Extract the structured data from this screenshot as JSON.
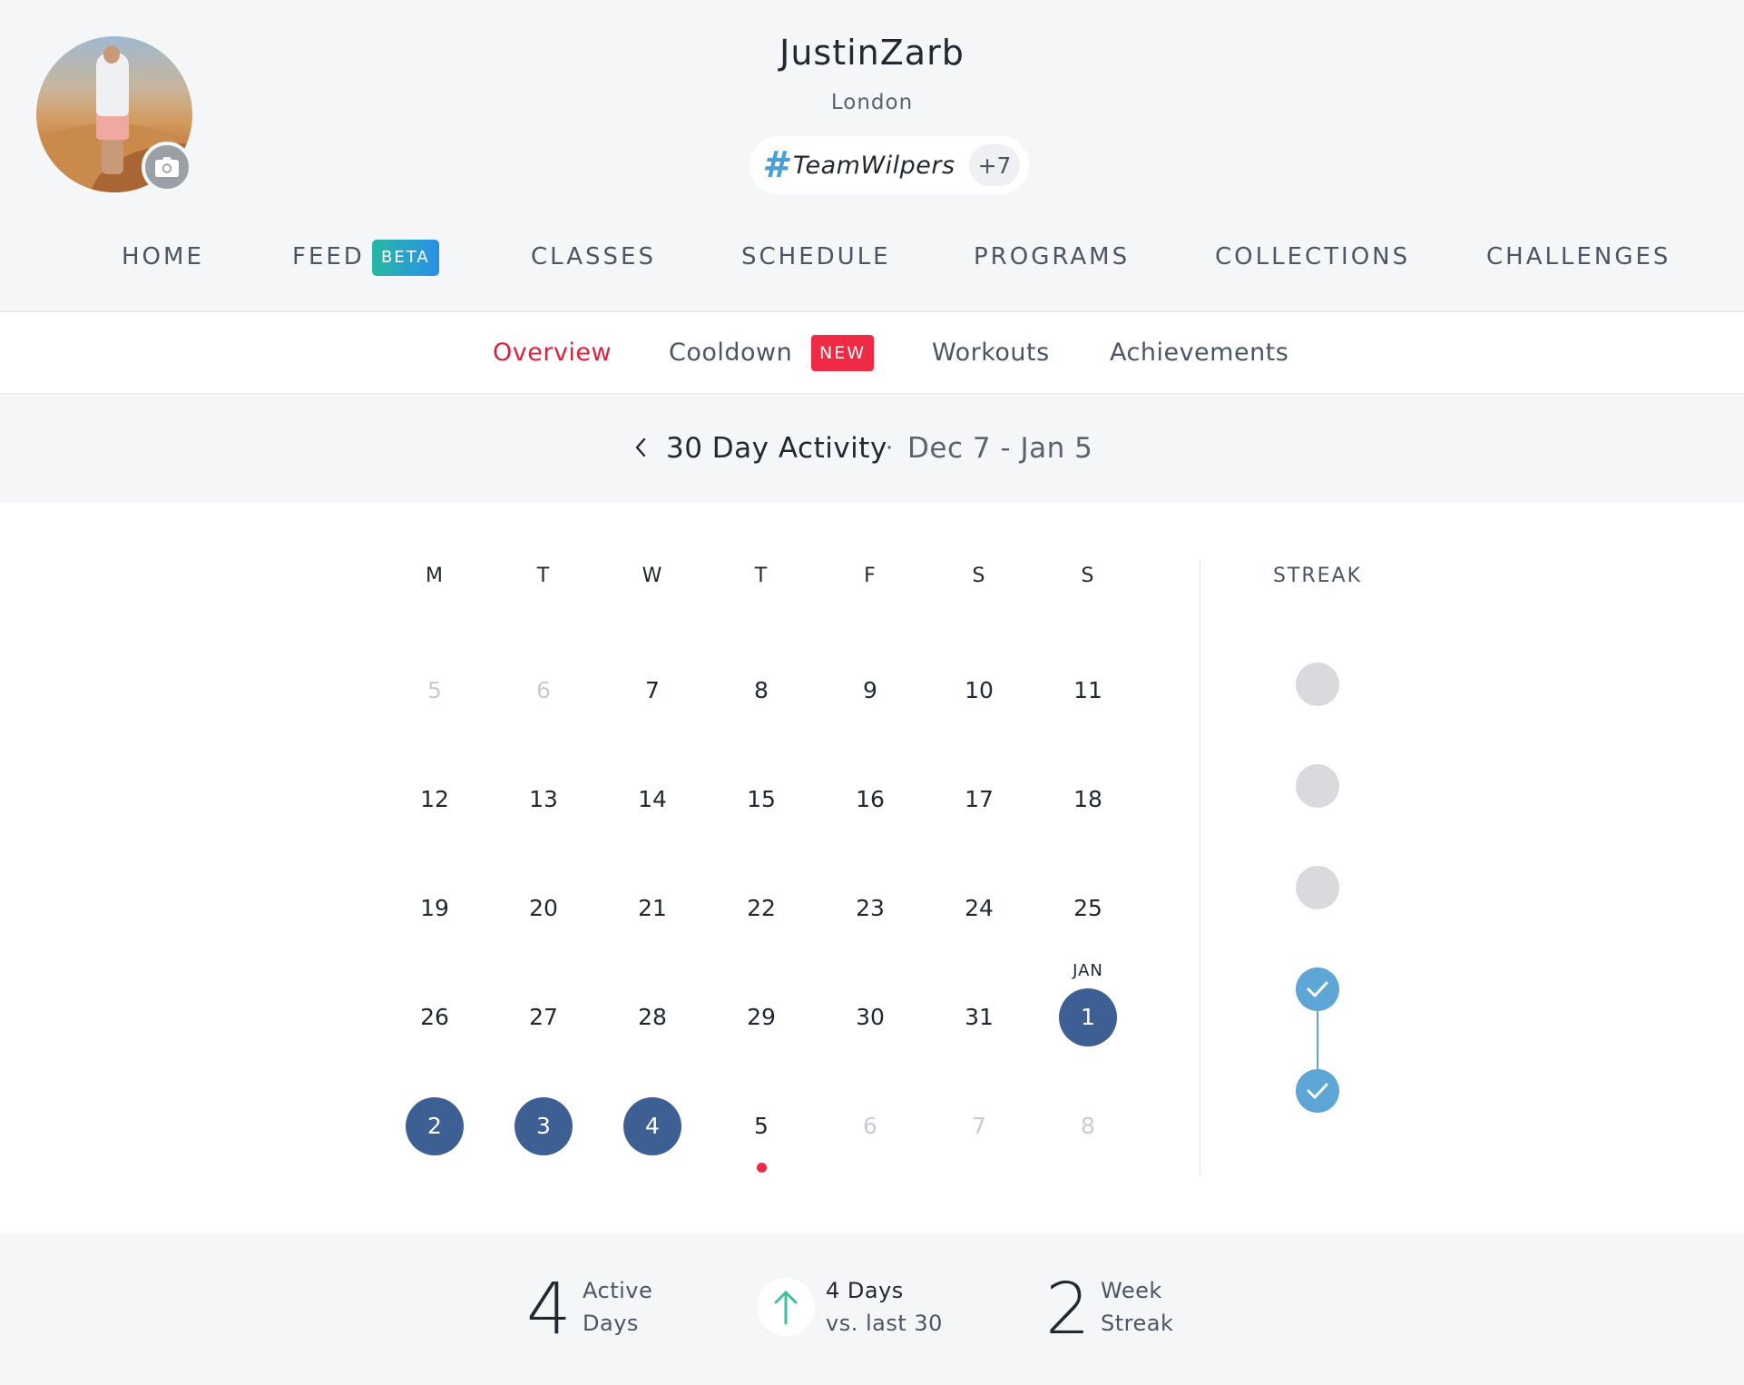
{
  "profile": {
    "username": "JustinZarb",
    "location": "London",
    "tag": {
      "hash": "#",
      "name": "TeamWilpers",
      "count": "+7"
    }
  },
  "main_nav": [
    {
      "label": "HOME"
    },
    {
      "label": "FEED",
      "badge": "BETA"
    },
    {
      "label": "CLASSES"
    },
    {
      "label": "SCHEDULE"
    },
    {
      "label": "PROGRAMS"
    },
    {
      "label": "COLLECTIONS"
    },
    {
      "label": "CHALLENGES"
    }
  ],
  "sub_nav": [
    {
      "label": "Overview",
      "active": true
    },
    {
      "label": "Cooldown",
      "badge": "NEW"
    },
    {
      "label": "Workouts"
    },
    {
      "label": "Achievements"
    }
  ],
  "period": {
    "title": "30 Day Activity",
    "separator": "·",
    "range": "Dec 7 - Jan 5"
  },
  "calendar": {
    "weekdays": [
      "M",
      "T",
      "W",
      "T",
      "F",
      "S",
      "S"
    ],
    "weeks": [
      [
        {
          "d": "5",
          "muted": true
        },
        {
          "d": "6",
          "muted": true
        },
        {
          "d": "7"
        },
        {
          "d": "8"
        },
        {
          "d": "9"
        },
        {
          "d": "10"
        },
        {
          "d": "11"
        }
      ],
      [
        {
          "d": "12"
        },
        {
          "d": "13"
        },
        {
          "d": "14"
        },
        {
          "d": "15"
        },
        {
          "d": "16"
        },
        {
          "d": "17"
        },
        {
          "d": "18"
        }
      ],
      [
        {
          "d": "19"
        },
        {
          "d": "20"
        },
        {
          "d": "21"
        },
        {
          "d": "22"
        },
        {
          "d": "23"
        },
        {
          "d": "24"
        },
        {
          "d": "25"
        }
      ],
      [
        {
          "d": "26"
        },
        {
          "d": "27"
        },
        {
          "d": "28"
        },
        {
          "d": "29"
        },
        {
          "d": "30"
        },
        {
          "d": "31"
        },
        {
          "d": "1",
          "active": true,
          "month": "JAN"
        }
      ],
      [
        {
          "d": "2",
          "active": true
        },
        {
          "d": "3",
          "active": true
        },
        {
          "d": "4",
          "active": true
        },
        {
          "d": "5",
          "today": true
        },
        {
          "d": "6",
          "muted": true
        },
        {
          "d": "7",
          "muted": true
        },
        {
          "d": "8",
          "muted": true
        }
      ]
    ],
    "streak_label": "STREAK",
    "streak_weeks": [
      false,
      false,
      false,
      true,
      true
    ]
  },
  "stats": {
    "active_days": {
      "value": "4",
      "line1": "Active",
      "line2": "Days"
    },
    "comparison": {
      "line1": "4 Days",
      "line2": "vs. last 30",
      "direction": "up"
    },
    "week_streak": {
      "value": "2",
      "line1": "Week",
      "line2": "Streak"
    }
  },
  "colors": {
    "accent_red": "#e01f3d",
    "active_day": "#3d5f93",
    "streak_blue": "#5ea6d6",
    "up_arrow": "#3cc0a0"
  },
  "icons": {
    "camera": "camera-icon",
    "back": "chevron-left-icon",
    "check": "check-icon",
    "up": "arrow-up-icon"
  }
}
